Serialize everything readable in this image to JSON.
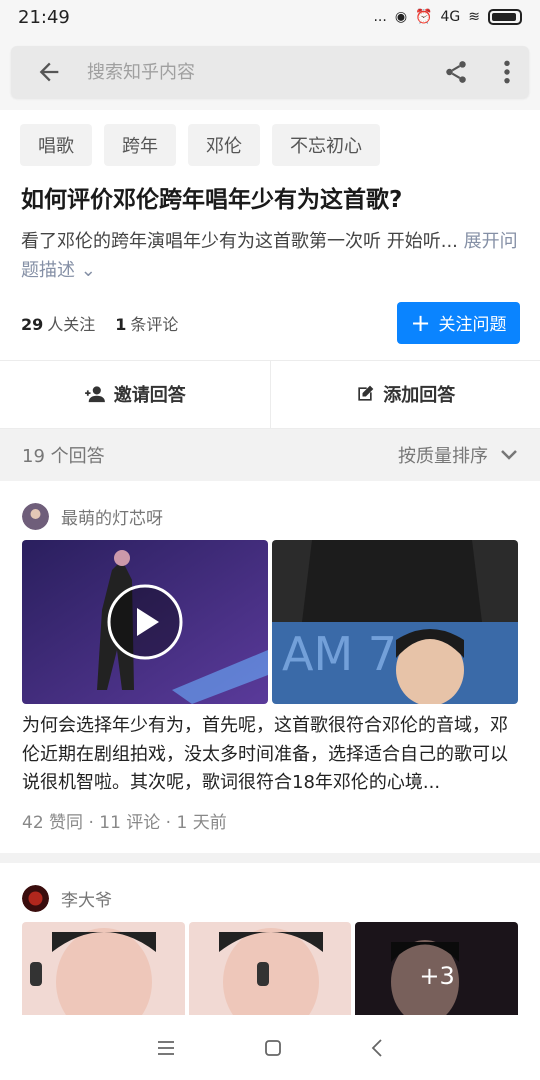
{
  "status": {
    "time": "21:49",
    "dots": "...",
    "network": "4G"
  },
  "search": {
    "placeholder": "搜索知乎内容"
  },
  "tags": [
    "唱歌",
    "跨年",
    "邓伦",
    "不忘初心"
  ],
  "question": {
    "title": "如何评价邓伦跨年唱年少有为这首歌?",
    "desc": "看了邓伦的跨年演唱年少有为这首歌第一次听 开始听...",
    "expand": "展开问题描述",
    "followers": "29",
    "followers_label": "人关注",
    "comments": "1",
    "comments_label": "条评论",
    "follow_button": "关注问题"
  },
  "actions": {
    "invite": "邀请回答",
    "add": "添加回答"
  },
  "sort": {
    "count": "19 个回答",
    "label": "按质量排序"
  },
  "answers": [
    {
      "author": "最萌的灯芯呀",
      "text": "为何会选择年少有为，首先呢，这首歌很符合邓伦的音域，邓伦近期在剧组拍戏，没太多时间准备，选择适合自己的歌可以说很机智啦。其次呢，歌词很符合18年邓伦的心境...",
      "meta": "42 赞同 · 11 评论 · 1 天前"
    },
    {
      "author": "李大爷",
      "more_images": "+3"
    }
  ],
  "colors": {
    "accent": "#0a84ff",
    "background": "#f6f6f6"
  }
}
